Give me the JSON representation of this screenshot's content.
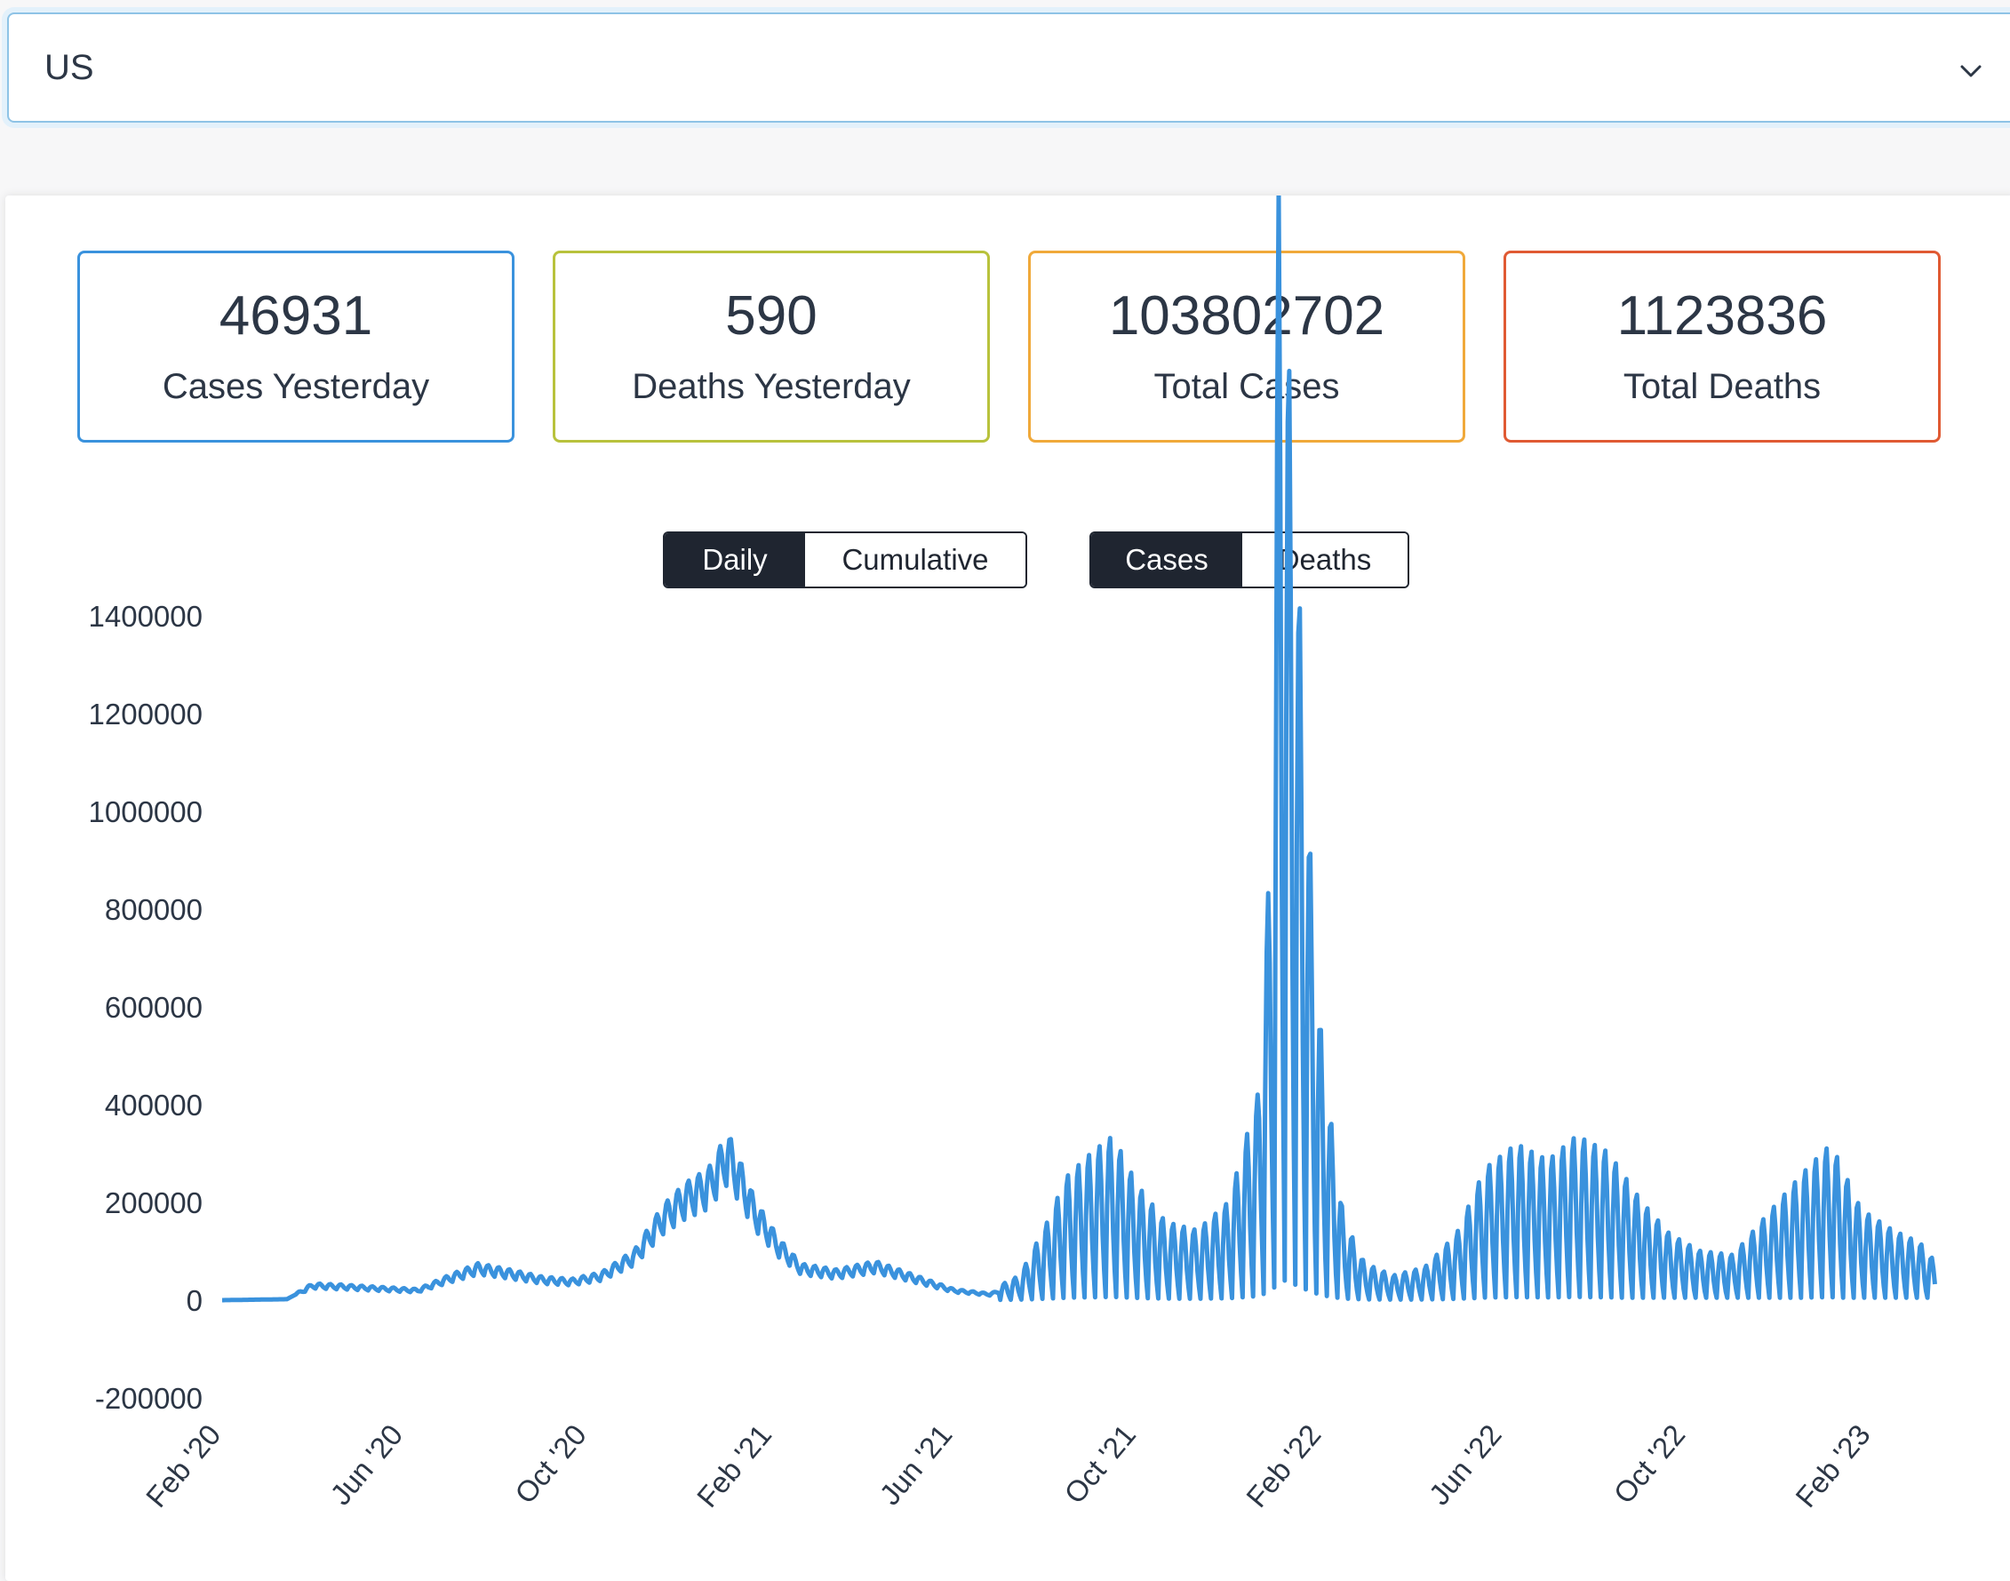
{
  "country_select": {
    "value": "US",
    "chevron_icon": "chevron-down-icon"
  },
  "stats": [
    {
      "value": "46931",
      "label": "Cases Yesterday",
      "color": "#3a92dd"
    },
    {
      "value": "590",
      "label": "Deaths Yesterday",
      "color": "#b8c23c"
    },
    {
      "value": "103802702",
      "label": "Total Cases",
      "color": "#f0a93a"
    },
    {
      "value": "1123836",
      "label": "Total Deaths",
      "color": "#e05a33"
    }
  ],
  "toggles": {
    "mode": {
      "options": [
        "Daily",
        "Cumulative"
      ],
      "selected": "Daily"
    },
    "metric": {
      "options": [
        "Cases",
        "Deaths"
      ],
      "selected": "Cases"
    }
  },
  "chart_data": {
    "type": "line",
    "ylim": [
      -200000,
      1400000
    ],
    "yticks": [
      "1400000",
      "1200000",
      "1000000",
      "800000",
      "600000",
      "400000",
      "200000",
      "0",
      "-200000"
    ],
    "xticks": [
      "Feb '20",
      "Jun '20",
      "Oct '20",
      "Feb '21",
      "Jun '21",
      "Oct '21",
      "Feb '22",
      "Jun '22",
      "Oct '22",
      "Feb '23"
    ],
    "color": "#3a92dd",
    "series": [
      {
        "values": [
          {
            "x": "2020-02-01",
            "y": 0
          },
          {
            "x": "2020-03-15",
            "y": 2000
          },
          {
            "x": "2020-04-01",
            "y": 30000
          },
          {
            "x": "2020-04-20",
            "y": 28000
          },
          {
            "x": "2020-05-15",
            "y": 24000
          },
          {
            "x": "2020-06-10",
            "y": 20000
          },
          {
            "x": "2020-07-01",
            "y": 45000
          },
          {
            "x": "2020-07-20",
            "y": 66000
          },
          {
            "x": "2020-08-10",
            "y": 55000
          },
          {
            "x": "2020-09-01",
            "y": 42000
          },
          {
            "x": "2020-09-20",
            "y": 38000
          },
          {
            "x": "2020-10-10",
            "y": 50000
          },
          {
            "x": "2020-11-01",
            "y": 90000
          },
          {
            "x": "2020-11-20",
            "y": 170000
          },
          {
            "x": "2020-12-05",
            "y": 210000
          },
          {
            "x": "2020-12-20",
            "y": 235000
          },
          {
            "x": "2021-01-02",
            "y": 300000
          },
          {
            "x": "2021-01-10",
            "y": 250000
          },
          {
            "x": "2021-01-20",
            "y": 180000
          },
          {
            "x": "2021-02-05",
            "y": 110000
          },
          {
            "x": "2021-02-20",
            "y": 65000
          },
          {
            "x": "2021-03-15",
            "y": 55000
          },
          {
            "x": "2021-04-10",
            "y": 70000
          },
          {
            "x": "2021-05-01",
            "y": 50000
          },
          {
            "x": "2021-06-01",
            "y": 20000
          },
          {
            "x": "2021-06-25",
            "y": 12000
          },
          {
            "x": "2021-07-15",
            "y": 30000
          },
          {
            "x": "2021-08-01",
            "y": 90000
          },
          {
            "x": "2021-08-15",
            "y": 150000
          },
          {
            "x": "2021-09-01",
            "y": 180000
          },
          {
            "x": "2021-09-15",
            "y": 200000
          },
          {
            "x": "2021-10-01",
            "y": 140000
          },
          {
            "x": "2021-10-20",
            "y": 95000
          },
          {
            "x": "2021-11-10",
            "y": 85000
          },
          {
            "x": "2021-12-01",
            "y": 120000
          },
          {
            "x": "2021-12-20",
            "y": 250000
          },
          {
            "x": "2021-12-30",
            "y": 600000
          },
          {
            "x": "2022-01-03",
            "y": 1350000
          },
          {
            "x": "2022-01-10",
            "y": 1130000
          },
          {
            "x": "2022-01-18",
            "y": 800000
          },
          {
            "x": "2022-01-25",
            "y": 500000
          },
          {
            "x": "2022-02-01",
            "y": 300000
          },
          {
            "x": "2022-02-15",
            "y": 100000
          },
          {
            "x": "2022-03-01",
            "y": 45000
          },
          {
            "x": "2022-03-20",
            "y": 30000
          },
          {
            "x": "2022-04-10",
            "y": 40000
          },
          {
            "x": "2022-05-01",
            "y": 80000
          },
          {
            "x": "2022-05-20",
            "y": 160000
          },
          {
            "x": "2022-06-10",
            "y": 190000
          },
          {
            "x": "2022-07-01",
            "y": 170000
          },
          {
            "x": "2022-07-20",
            "y": 200000
          },
          {
            "x": "2022-08-10",
            "y": 180000
          },
          {
            "x": "2022-09-01",
            "y": 120000
          },
          {
            "x": "2022-09-20",
            "y": 80000
          },
          {
            "x": "2022-10-10",
            "y": 60000
          },
          {
            "x": "2022-11-01",
            "y": 55000
          },
          {
            "x": "2022-12-01",
            "y": 120000
          },
          {
            "x": "2022-12-20",
            "y": 160000
          },
          {
            "x": "2023-01-05",
            "y": 190000
          },
          {
            "x": "2023-01-25",
            "y": 110000
          },
          {
            "x": "2023-02-15",
            "y": 85000
          },
          {
            "x": "2023-03-05",
            "y": 70000
          },
          {
            "x": "2023-03-15",
            "y": 47000
          }
        ]
      }
    ]
  }
}
